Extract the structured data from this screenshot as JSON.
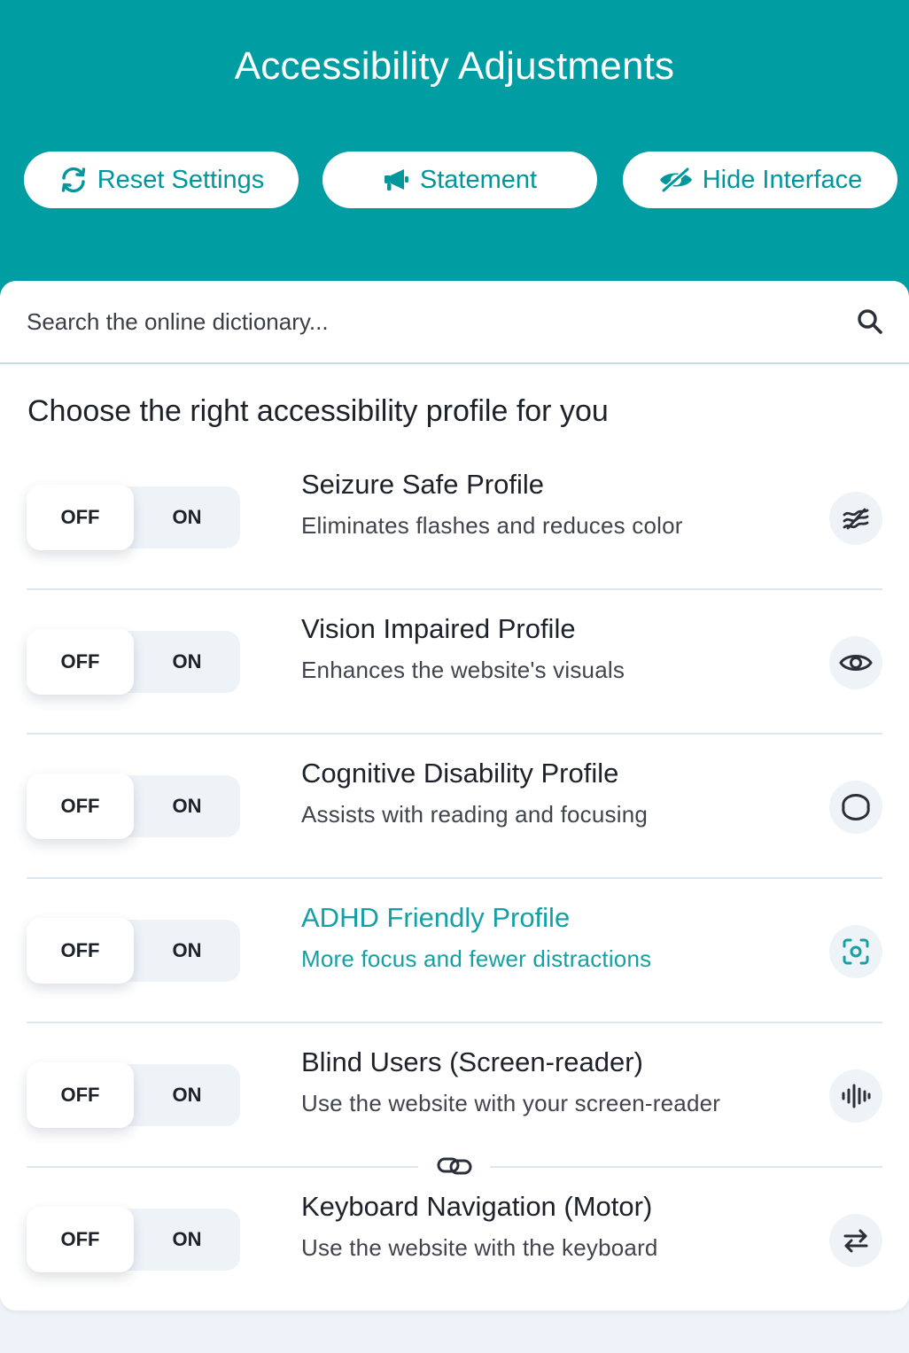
{
  "header": {
    "title": "Accessibility Adjustments",
    "buttons": {
      "reset": "Reset Settings",
      "statement": "Statement",
      "hide": "Hide Interface"
    }
  },
  "search": {
    "placeholder": "Search the online dictionary..."
  },
  "section_title": "Choose the right accessibility profile for you",
  "toggle": {
    "off": "OFF",
    "on": "ON"
  },
  "profiles": [
    {
      "title": "Seizure Safe Profile",
      "description": "Eliminates flashes and reduces color",
      "icon": "waves-icon"
    },
    {
      "title": "Vision Impaired Profile",
      "description": "Enhances the website's visuals",
      "icon": "eye-icon"
    },
    {
      "title": "Cognitive Disability Profile",
      "description": "Assists with reading and focusing",
      "icon": "brain-outline-icon"
    },
    {
      "title": "ADHD Friendly Profile",
      "description": "More focus and fewer distractions",
      "icon": "focus-target-icon",
      "highlighted": true
    },
    {
      "title": "Blind Users (Screen-reader)",
      "description": "Use the website with your screen-reader",
      "icon": "audio-waveform-icon"
    },
    {
      "title": "Keyboard Navigation (Motor)",
      "description": "Use the website with the keyboard",
      "icon": "arrows-left-right-icon"
    }
  ],
  "colors": {
    "brand": "#009ea3",
    "highlight_text": "#14a0a4",
    "panel_bg": "#ffffff",
    "page_bg": "#eef3f9"
  }
}
